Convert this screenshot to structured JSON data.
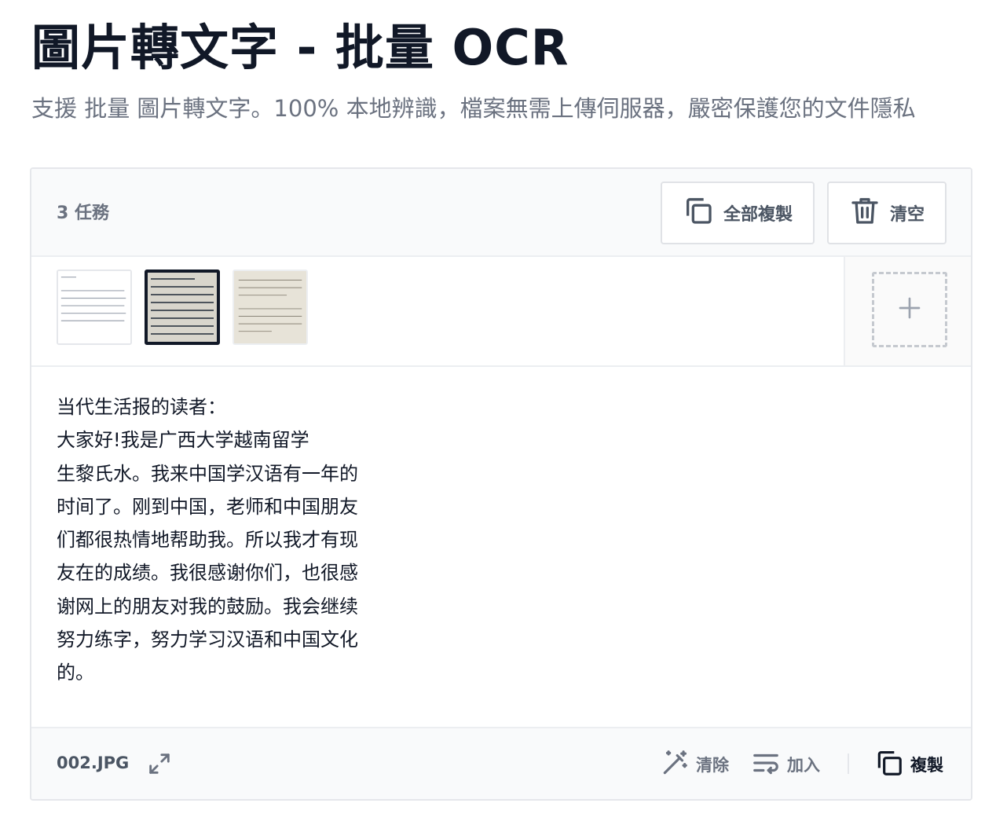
{
  "page": {
    "title": "圖片轉文字 - 批量 OCR",
    "subtitle": "支援 批量 圖片轉文字。100% 本地辨識，檔案無需上傳伺服器，嚴密保護您的文件隱私"
  },
  "toolbar": {
    "task_count": "3 任務",
    "copy_all_label": "全部複製",
    "clear_label": "清空"
  },
  "thumbnails": [
    {
      "name": "thumb-1",
      "selected": false
    },
    {
      "name": "thumb-2",
      "selected": true
    },
    {
      "name": "thumb-3",
      "selected": false
    }
  ],
  "result": {
    "text": "当代生活报的读者：\n大家好!我是广西大学越南留学\n生黎氏水。我来中国学汉语有一年的\n时间了。刚到中国，老师和中国朋友\n们都很热情地帮助我。所以我才有现\n友在的成绩。我很感谢你们，也很感\n谢网上的朋友对我的鼓励。我会继续\n努力练字，努力学习汉语和中国文化\n的。"
  },
  "footer": {
    "file_name": "002.JPG",
    "clean_label": "清除",
    "join_label": "加入",
    "copy_label": "複製"
  },
  "icons": {
    "copy_all": "copy-icon",
    "clear": "trash-icon",
    "add": "plus-icon",
    "expand": "expand-icon",
    "clean": "magic-wand-icon",
    "join": "wrap-lines-icon",
    "copy": "copy-icon"
  },
  "colors": {
    "title": "#111827",
    "subtitle": "#6b7280",
    "border": "#e5e7eb",
    "selected_thumb_border": "#111827"
  }
}
